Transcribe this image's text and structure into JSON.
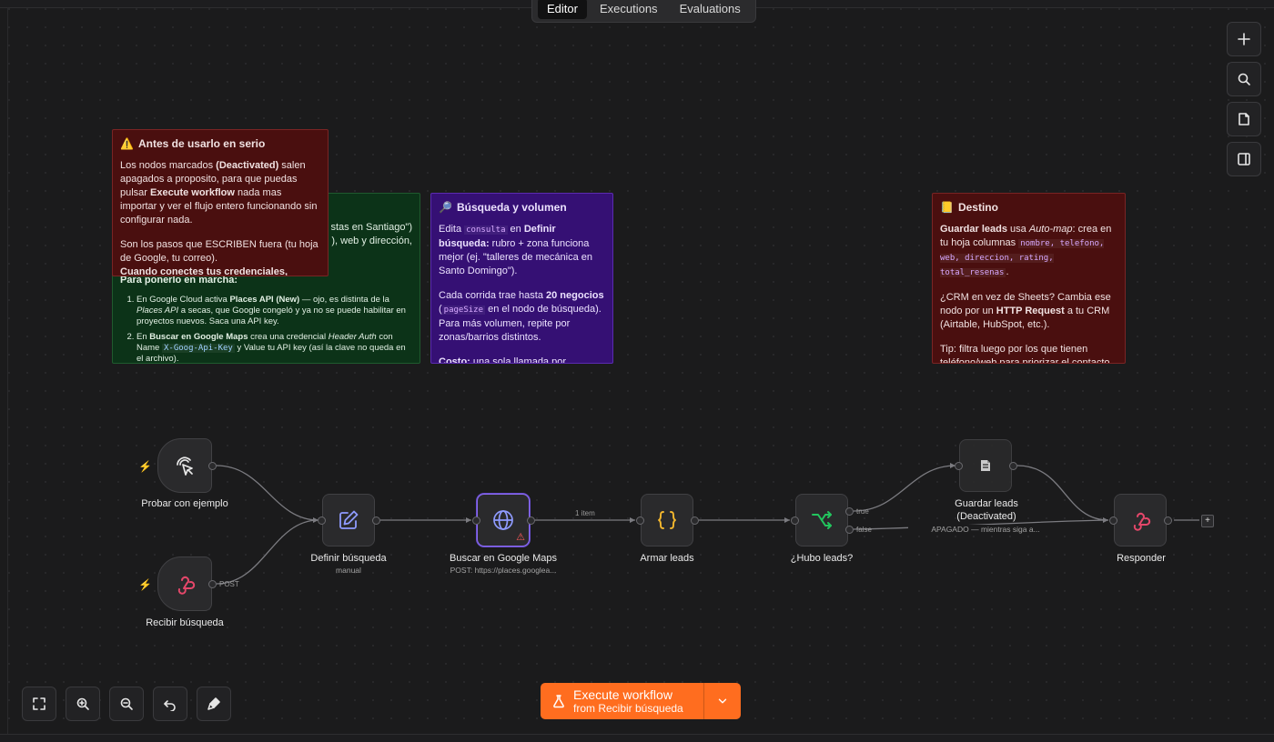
{
  "tabs": [
    {
      "label": "Editor",
      "active": true
    },
    {
      "label": "Executions",
      "active": false
    },
    {
      "label": "Evaluations",
      "active": false
    }
  ],
  "right_toolbar": [
    "plus-icon",
    "search-icon",
    "sticky-note-icon",
    "panel-icon"
  ],
  "sticky_warning": {
    "emoji": "⚠️",
    "title": "Antes de usarlo en serio",
    "p1_a": "Los nodos marcados ",
    "p1_b": "(Deactivated)",
    "p1_c": " salen apagados a proposito, para que puedas pulsar ",
    "p1_d": "Execute workflow",
    "p1_e": " nada mas importar y ver el flujo entero funcionando sin configurar nada.",
    "p2": "Son los pasos que ESCRIBEN fuera (tu hoja de Google, tu correo).",
    "p3": "Cuando conectes tus credenciales, activalos"
  },
  "sticky_setup": {
    "hidden_line1": "stas en Santiago\")",
    "hidden_line2": "), web y dirección,",
    "title": "Para ponerlo en marcha:",
    "step1_a": "En Google Cloud activa ",
    "step1_b": "Places API (New)",
    "step1_c": " — ojo, es distinta de la ",
    "step1_d": "Places API",
    "step1_e": " a secas, que Google congeló y ya no se puede habilitar en proyectos nuevos. Saca una API key.",
    "step2_a": "En ",
    "step2_b": "Buscar en Google Maps",
    "step2_c": " crea una credencial ",
    "step2_d": "Header Auth",
    "step2_e": " con Name ",
    "step2_code": "X-Goog-Api-Key",
    "step2_f": " y Value tu API key (así la clave no queda en el archivo)."
  },
  "sticky_search": {
    "emoji": "🔎",
    "title": "Búsqueda y volumen",
    "p1_a": "Edita ",
    "p1_code": "consulta",
    "p1_b": " en ",
    "p1_c": "Definir búsqueda:",
    "p1_d": " rubro + zona funciona mejor (ej. \"talleres de mecánica en Santo Domingo\").",
    "p2_a": "Cada corrida trae hasta ",
    "p2_b": "20 negocios",
    "p2_c": " (",
    "p2_code": "pageSize",
    "p2_d": " en el nodo de búsqueda). Para más volumen, repite por zonas/barrios distintos.",
    "p3_a": "Costo:",
    "p3_b": " una sola llamada por búsqueda"
  },
  "sticky_dest": {
    "emoji": "📒",
    "title": "Destino",
    "p1_a": "Guardar leads",
    "p1_b": " usa ",
    "p1_c": "Auto-map",
    "p1_d": ": crea en tu hoja columnas ",
    "p1_code": "nombre, telefono, web, direccion, rating, total_resenas",
    "p1_e": ".",
    "p2_a": "¿CRM en vez de Sheets? Cambia ese nodo por un ",
    "p2_b": "HTTP Request",
    "p2_c": " a tu CRM (Airtable, HubSpot, etc.).",
    "p3": "Tip: filtra luego por los que tienen teléfono/web para priorizar el contacto."
  },
  "nodes": {
    "probar": {
      "label": "Probar con ejemplo"
    },
    "recibir": {
      "label": "Recibir búsqueda",
      "port_label": "POST"
    },
    "definir": {
      "label": "Definir búsqueda",
      "sub": "manual"
    },
    "buscar": {
      "label": "Buscar en Google Maps",
      "sub": "POST: https://places.googlea..."
    },
    "armar": {
      "label": "Armar leads"
    },
    "hubo": {
      "label": "¿Hubo leads?",
      "true_label": "true",
      "false_label": "false"
    },
    "guardar": {
      "label_line1": "Guardar leads",
      "label_line2": "(Deactivated)",
      "sub": "APAGADO — mientras siga a..."
    },
    "responder": {
      "label": "Responder"
    }
  },
  "edge_label_items": "1 item",
  "bottom_controls": [
    "fit-view-icon",
    "zoom-in-icon",
    "zoom-out-icon",
    "undo-icon",
    "tidy-up-icon"
  ],
  "execute": {
    "title": "Execute workflow",
    "sub": "from Recibir búsqueda"
  },
  "colors": {
    "accent": "#ff6d1f",
    "webhook": "#e5476a",
    "switch": "#22c55e",
    "code": "#f5b82e",
    "http": "#8f9bff"
  }
}
